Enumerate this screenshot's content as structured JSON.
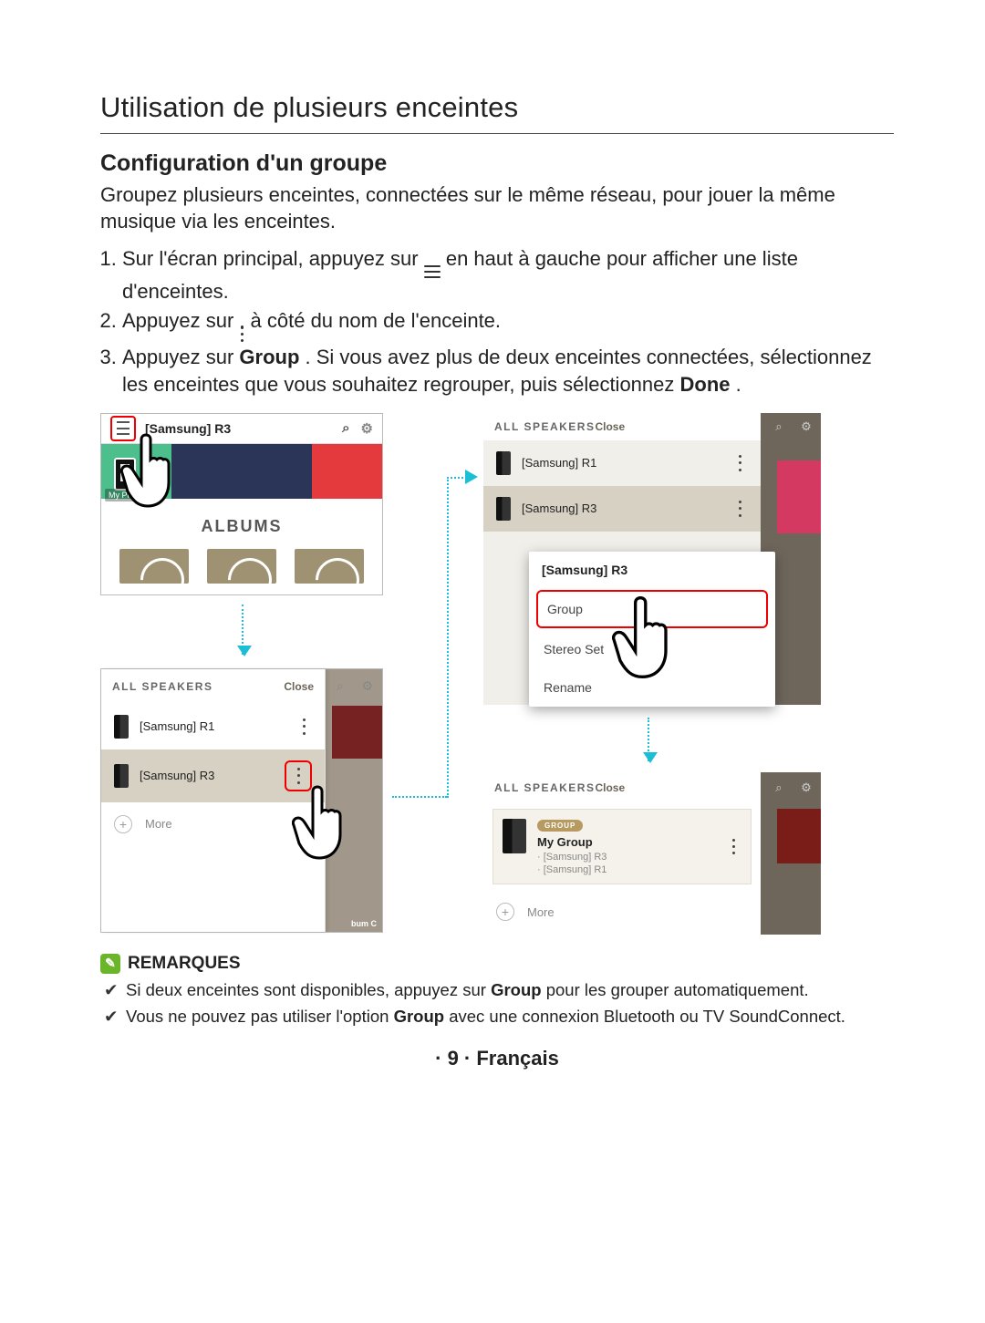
{
  "title": "Utilisation de plusieurs enceintes",
  "subtitle": "Configuration d'un groupe",
  "intro": "Groupez plusieurs enceintes, connectées sur le même réseau, pour jouer la même musique via les enceintes.",
  "steps": {
    "s1a": "Sur l'écran principal, appuyez sur ",
    "s1b": " en haut à gauche pour afficher une liste d'enceintes.",
    "s2a": "Appuyez sur ",
    "s2b": " à côté du nom de l'enceinte.",
    "s3a": "Appuyez sur ",
    "s3_group": "Group",
    "s3b": ". Si vous avez plus de deux enceintes connectées, sélectionnez les enceintes que vous souhaitez regrouper, puis sélectionnez ",
    "s3_done": "Done",
    "s3c": "."
  },
  "panelA": {
    "device": "[Samsung] R3",
    "albums_label": "ALBUMS",
    "phone_label": "My Phone"
  },
  "panelB": {
    "header": "ALL SPEAKERS",
    "close": "Close",
    "spk1": "[Samsung] R1",
    "spk2": "[Samsung] R3",
    "more": "More",
    "bg_label": "bum C"
  },
  "panelC": {
    "header": "ALL SPEAKERS",
    "close": "Close",
    "spk1": "[Samsung] R1",
    "spk2": "[Samsung] R3",
    "popup": {
      "title": "[Samsung] R3",
      "opt_group": "Group",
      "opt_stereo": "Stereo Set",
      "opt_rename": "Rename"
    }
  },
  "panelD": {
    "header": "ALL SPEAKERS",
    "close": "Close",
    "badge": "GROUP",
    "group_title": "My Group",
    "sub1": "· [Samsung] R3",
    "sub2": "· [Samsung] R1",
    "more": "More"
  },
  "remarks": {
    "title": "REMARQUES",
    "note1a": "Si deux enceintes sont disponibles, appuyez sur ",
    "note1_bold": "Group",
    "note1b": " pour les grouper automatiquement.",
    "note2a": "Vous ne pouvez pas utiliser l'option ",
    "note2_bold": "Group",
    "note2b": " avec une connexion Bluetooth ou TV SoundConnect."
  },
  "footer": "· 9 · Français"
}
